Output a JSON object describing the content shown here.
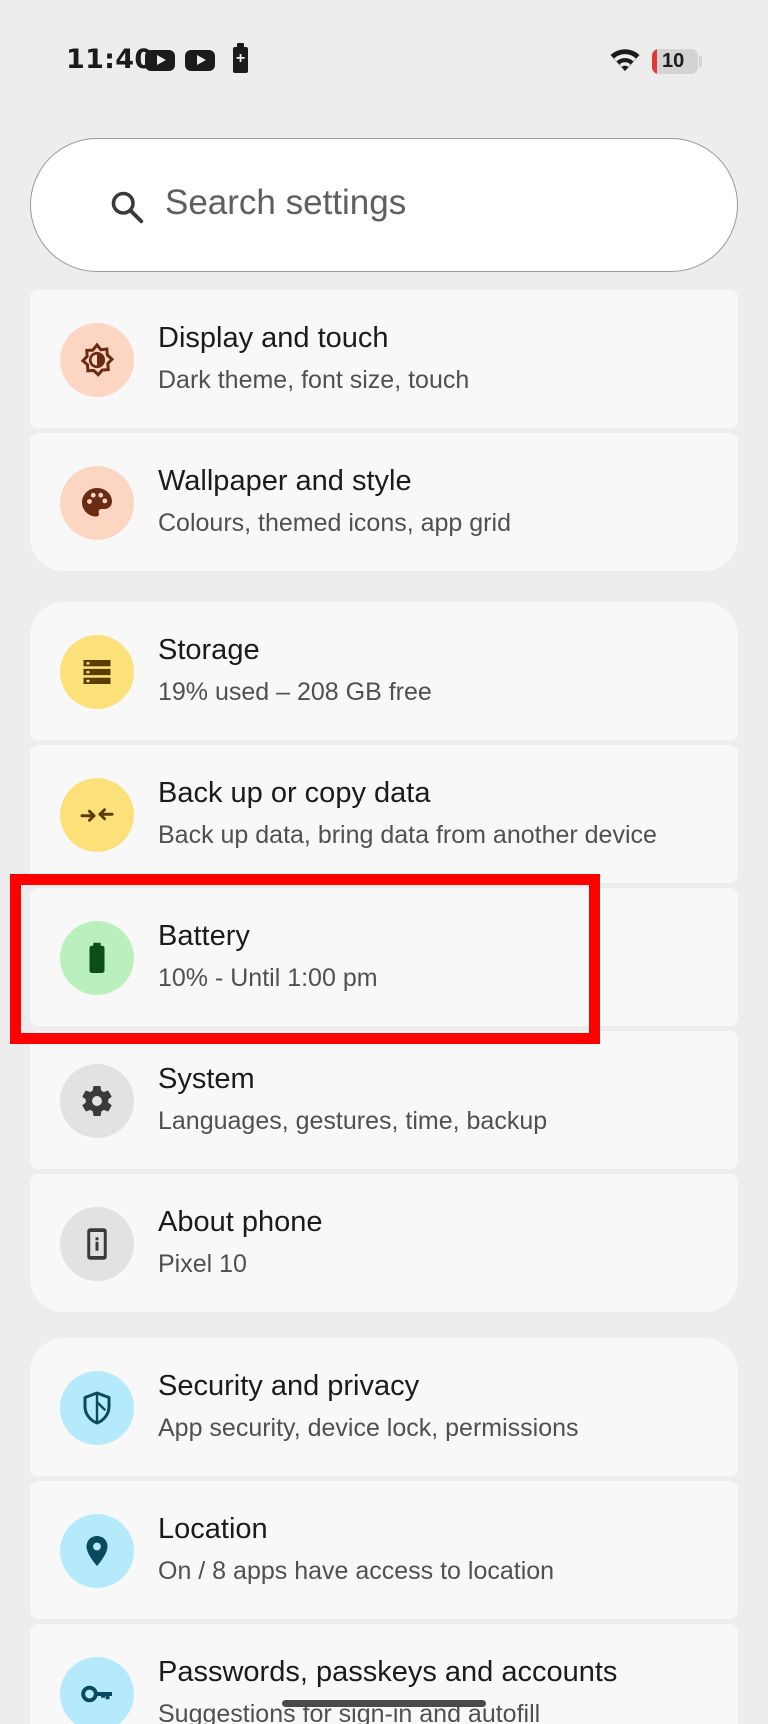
{
  "status_bar": {
    "time": "11:40",
    "battery_level": "10",
    "battery_fraction": 0.1,
    "icons": [
      "youtube-icon",
      "youtube-icon",
      "battery-charge-icon",
      "wifi-icon",
      "battery-icon"
    ]
  },
  "search": {
    "placeholder": "Search settings"
  },
  "groups": [
    {
      "items": [
        {
          "name": "display",
          "title": "Display and touch",
          "subtitle": "Dark theme, font size, touch",
          "icon": "brightness-icon",
          "icon_bg": "#fcd6c3",
          "icon_fg": "#6b2b12"
        },
        {
          "name": "wallpaper",
          "title": "Wallpaper and style",
          "subtitle": "Colours, themed icons, app grid",
          "icon": "palette-icon",
          "icon_bg": "#fcd6c3",
          "icon_fg": "#6b2b12"
        }
      ]
    },
    {
      "items": [
        {
          "name": "storage",
          "title": "Storage",
          "subtitle": "19% used – 208 GB free",
          "icon": "storage-icon",
          "icon_bg": "#fce17a",
          "icon_fg": "#5b3d00"
        },
        {
          "name": "backup",
          "title": "Back up or copy data",
          "subtitle": "Back up data, bring data from another device",
          "icon": "transfer-arrows-icon",
          "icon_bg": "#fce17a",
          "icon_fg": "#5b3d00"
        },
        {
          "name": "battery",
          "title": "Battery",
          "subtitle": "10% - Until 1:00 pm",
          "icon": "battery-icon",
          "icon_bg": "#b9f0bd",
          "icon_fg": "#0d4d1c"
        },
        {
          "name": "system",
          "title": "System",
          "subtitle": "Languages, gestures, time, backup",
          "icon": "gear-icon",
          "icon_bg": "#e2e2e2",
          "icon_fg": "#3a3a3a"
        },
        {
          "name": "about",
          "title": "About phone",
          "subtitle": "Pixel 10",
          "icon": "phone-info-icon",
          "icon_bg": "#e2e2e2",
          "icon_fg": "#3a3a3a"
        }
      ]
    },
    {
      "items": [
        {
          "name": "security",
          "title": "Security and privacy",
          "subtitle": "App security, device lock, permissions",
          "icon": "shield-icon",
          "icon_bg": "#b5eafd",
          "icon_fg": "#0b4a5e"
        },
        {
          "name": "location",
          "title": "Location",
          "subtitle": "On / 8 apps have access to location",
          "icon": "location-pin-icon",
          "icon_bg": "#b5eafd",
          "icon_fg": "#0b4a5e"
        },
        {
          "name": "passwords",
          "title": "Passwords, passkeys and accounts",
          "subtitle": "Suggestions for sign-in and autofill",
          "icon": "key-icon",
          "icon_bg": "#b5eafd",
          "icon_fg": "#0b4a5e"
        }
      ]
    }
  ],
  "highlight": {
    "target": "battery",
    "color": "#ff0000"
  }
}
